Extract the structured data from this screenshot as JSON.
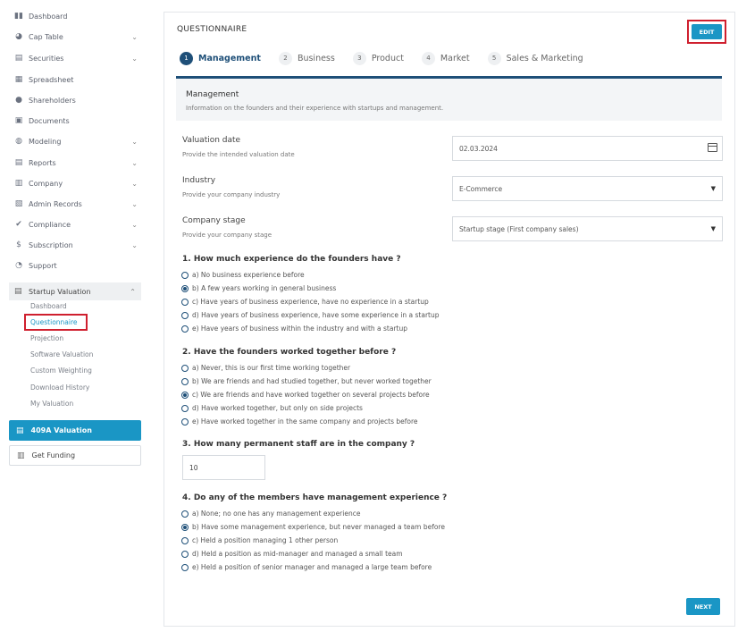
{
  "sidebar": {
    "items": [
      {
        "label": "Dashboard",
        "icon": "dashboard-icon",
        "glyph": "▮▮",
        "chevron": false
      },
      {
        "label": "Cap Table",
        "icon": "pie-chart-icon",
        "glyph": "◕",
        "chevron": true
      },
      {
        "label": "Securities",
        "icon": "document-icon",
        "glyph": "▤",
        "chevron": true
      },
      {
        "label": "Spreadsheet",
        "icon": "spreadsheet-icon",
        "glyph": "▦",
        "chevron": false
      },
      {
        "label": "Shareholders",
        "icon": "user-icon",
        "glyph": "●",
        "chevron": false
      },
      {
        "label": "Documents",
        "icon": "folder-icon",
        "glyph": "▣",
        "chevron": false
      },
      {
        "label": "Modeling",
        "icon": "lightbulb-icon",
        "glyph": "◍",
        "chevron": true
      },
      {
        "label": "Reports",
        "icon": "report-icon",
        "glyph": "▤",
        "chevron": true
      },
      {
        "label": "Company",
        "icon": "building-icon",
        "glyph": "▥",
        "chevron": true
      },
      {
        "label": "Admin Records",
        "icon": "records-icon",
        "glyph": "▧",
        "chevron": true
      },
      {
        "label": "Compliance",
        "icon": "shield-check-icon",
        "glyph": "✔",
        "chevron": true
      },
      {
        "label": "Subscription",
        "icon": "dollar-icon",
        "glyph": "$",
        "chevron": true
      },
      {
        "label": "Support",
        "icon": "support-icon",
        "glyph": "◔",
        "chevron": false
      }
    ],
    "startup_valuation": {
      "label": "Startup Valuation",
      "icon": "document-icon",
      "subitems": [
        "Dashboard",
        "Questionnaire",
        "Projection",
        "Software Valuation",
        "Custom Weighting",
        "Download History",
        "My Valuation"
      ],
      "active_index": 1
    },
    "btn_409a": "409A Valuation",
    "btn_funding": "Get Funding",
    "chevron_down": "⌄",
    "chevron_up": "⌃"
  },
  "main": {
    "title": "QUESTIONNAIRE",
    "edit_label": "EDIT",
    "next_label": "NEXT",
    "tabs": [
      {
        "num": "1",
        "label": "Management"
      },
      {
        "num": "2",
        "label": "Business"
      },
      {
        "num": "3",
        "label": "Product"
      },
      {
        "num": "4",
        "label": "Market"
      },
      {
        "num": "5",
        "label": "Sales & Marketing"
      }
    ],
    "section": {
      "title": "Management",
      "description": "Information on the founders and their experience with startups and management."
    },
    "fields": {
      "valuation_date": {
        "label": "Valuation date",
        "help": "Provide the intended valuation date",
        "value": "02.03.2024"
      },
      "industry": {
        "label": "Industry",
        "help": "Provide your company industry",
        "value": "E-Commerce"
      },
      "company_stage": {
        "label": "Company stage",
        "help": "Provide your company stage",
        "value": "Startup stage (First company sales)"
      }
    },
    "questions": [
      {
        "title": "1. How much experience do the founders have ?",
        "selected": 1,
        "options": [
          "a) No business experience before",
          "b) A few years working in general business",
          "c) Have years of business experience, have no experience in a startup",
          "d) Have years of business experience, have some experience in a startup",
          "e) Have years of business within the industry and with a startup"
        ]
      },
      {
        "title": "2. Have the founders worked together before ?",
        "selected": 2,
        "options": [
          "a) Never, this is our first time working together",
          "b) We are friends and had studied together, but never worked together",
          "c) We are friends and have worked together on several projects before",
          "d) Have worked together, but only on side projects",
          "e) Have worked together in the same company and projects before"
        ]
      },
      {
        "title": "3. How many permanent staff are in the company ?",
        "value": "10"
      },
      {
        "title": "4. Do any of the members have management experience ?",
        "selected": 1,
        "options": [
          "a) None; no one has any management experience",
          "b) Have some management experience, but never managed a team before",
          "c) Held a position managing 1 other person",
          "d) Held a position as mid-manager and managed a small team",
          "e) Held a position of senior manager and managed a large team before"
        ]
      }
    ]
  },
  "colors": {
    "accent": "#1a96c5",
    "navy": "#1e4f78",
    "highlight": "#cf1f2e"
  }
}
